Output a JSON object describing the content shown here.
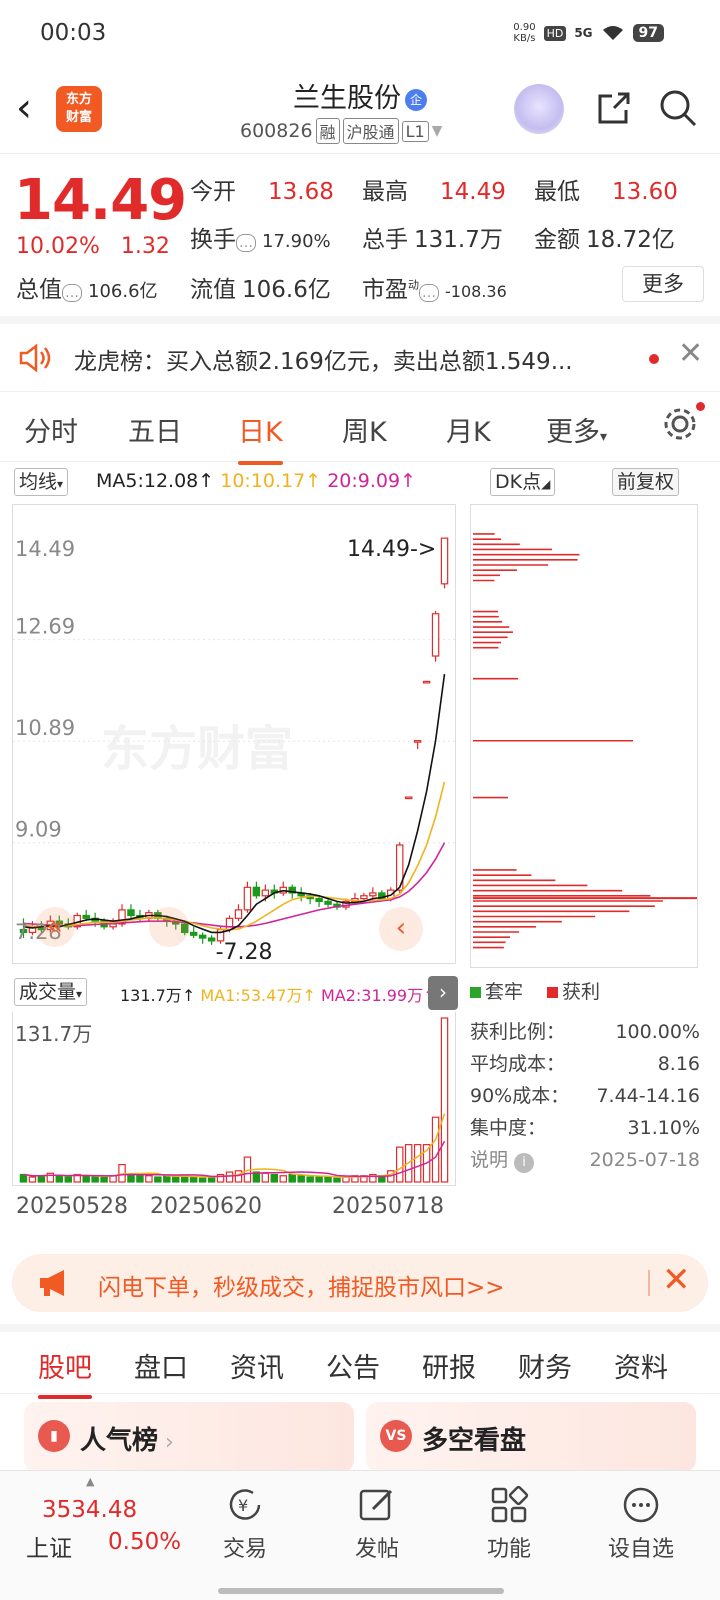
{
  "status": {
    "time": "00:03",
    "net_speed": "0.90\nKB/s",
    "hd": "HD",
    "signal": "5G",
    "battery": "97"
  },
  "header": {
    "logo_text_1": "东方",
    "logo_text_2": "财富",
    "stock_name": "兰生股份",
    "stock_badge": "企",
    "code": "600826",
    "tags": [
      "融",
      "沪股通",
      "L1"
    ]
  },
  "quote": {
    "price": "14.49",
    "change_pct": "10.02%",
    "change_amt": "1.32",
    "open_label": "今开",
    "open": "13.68",
    "high_label": "最高",
    "high": "14.49",
    "low_label": "最低",
    "low": "13.60",
    "turnover_label": "换手",
    "turnover": "17.90%",
    "volume_label": "总手",
    "volume": "131.7万",
    "amount_label": "金额",
    "amount": "18.72亿",
    "mktcap_label": "总值",
    "mktcap": "106.6亿",
    "float_label": "流值",
    "float": "106.6亿",
    "pe_label": "市盈",
    "pe_sup": "动",
    "pe": "-108.36",
    "more": "更多"
  },
  "notice": {
    "text": "龙虎榜：买入总额2.169亿元，卖出总额1.549..."
  },
  "period_tabs": [
    "分时",
    "五日",
    "日K",
    "周K",
    "月K",
    "更多"
  ],
  "active_period": "日K",
  "ma_bar": {
    "selector": "均线",
    "ma5": "MA5:12.08",
    "ma10": "10:10.17",
    "ma20": "20:9.09",
    "dk": "DK点",
    "adj": "前复权"
  },
  "chart_data": {
    "type": "candlestick",
    "y_ticks": [
      "14.49",
      "12.69",
      "10.89",
      "9.09",
      "7.28"
    ],
    "ylim": [
      7.1,
      14.9
    ],
    "last_label": "14.49->",
    "low_label": "-7.28",
    "watermark": "东方财富",
    "candles": [
      [
        7.55,
        7.5,
        7.75,
        7.4
      ],
      [
        7.5,
        7.6,
        7.7,
        7.45
      ],
      [
        7.6,
        7.55,
        7.7,
        7.5
      ],
      [
        7.55,
        7.7,
        7.8,
        7.5
      ],
      [
        7.7,
        7.65,
        7.8,
        7.6
      ],
      [
        7.65,
        7.6,
        7.75,
        7.55
      ],
      [
        7.6,
        7.8,
        7.85,
        7.55
      ],
      [
        7.8,
        7.75,
        7.9,
        7.7
      ],
      [
        7.75,
        7.7,
        7.85,
        7.6
      ],
      [
        7.7,
        7.6,
        7.75,
        7.55
      ],
      [
        7.6,
        7.65,
        7.75,
        7.55
      ],
      [
        7.65,
        7.9,
        8.0,
        7.6
      ],
      [
        7.9,
        7.8,
        8.0,
        7.75
      ],
      [
        7.8,
        7.75,
        7.9,
        7.7
      ],
      [
        7.75,
        7.85,
        7.9,
        7.7
      ],
      [
        7.85,
        7.75,
        7.9,
        7.7
      ],
      [
        7.75,
        7.7,
        7.8,
        7.6
      ],
      [
        7.7,
        7.65,
        7.75,
        7.55
      ],
      [
        7.65,
        7.5,
        7.7,
        7.45
      ],
      [
        7.5,
        7.45,
        7.6,
        7.4
      ],
      [
        7.45,
        7.4,
        7.5,
        7.3
      ],
      [
        7.4,
        7.35,
        7.45,
        7.28
      ],
      [
        7.35,
        7.55,
        7.6,
        7.3
      ],
      [
        7.55,
        7.75,
        7.8,
        7.5
      ],
      [
        7.75,
        7.9,
        8.0,
        7.7
      ],
      [
        7.9,
        8.3,
        8.4,
        7.85
      ],
      [
        8.3,
        8.15,
        8.4,
        8.1
      ],
      [
        8.15,
        8.25,
        8.35,
        8.05
      ],
      [
        8.25,
        8.2,
        8.35,
        8.1
      ],
      [
        8.2,
        8.3,
        8.4,
        8.15
      ],
      [
        8.3,
        8.2,
        8.35,
        8.1
      ],
      [
        8.2,
        8.15,
        8.3,
        8.05
      ],
      [
        8.15,
        8.1,
        8.2,
        8.0
      ],
      [
        8.1,
        8.05,
        8.15,
        7.95
      ],
      [
        8.05,
        8.0,
        8.1,
        7.95
      ],
      [
        8.0,
        7.95,
        8.05,
        7.9
      ],
      [
        7.95,
        8.05,
        8.1,
        7.9
      ],
      [
        8.05,
        8.1,
        8.2,
        8.0
      ],
      [
        8.1,
        8.15,
        8.2,
        8.05
      ],
      [
        8.15,
        8.2,
        8.3,
        8.1
      ],
      [
        8.2,
        8.1,
        8.25,
        8.05
      ],
      [
        8.1,
        8.25,
        8.3,
        8.05
      ],
      [
        8.25,
        9.05,
        9.1,
        8.2
      ],
      [
        9.9,
        9.9,
        9.9,
        9.9
      ],
      [
        10.9,
        10.9,
        10.9,
        10.75
      ],
      [
        11.95,
        11.95,
        11.95,
        11.95
      ],
      [
        12.4,
        13.15,
        13.2,
        12.3
      ],
      [
        13.68,
        14.49,
        14.49,
        13.6
      ]
    ],
    "ma5": [
      7.6,
      7.58,
      7.6,
      7.62,
      7.6,
      7.64,
      7.68,
      7.72,
      7.74,
      7.72,
      7.7,
      7.72,
      7.74,
      7.78,
      7.8,
      7.8,
      7.78,
      7.74,
      7.7,
      7.62,
      7.56,
      7.5,
      7.5,
      7.54,
      7.62,
      7.8,
      8.0,
      8.1,
      8.2,
      8.24,
      8.22,
      8.2,
      8.18,
      8.15,
      8.1,
      8.05,
      8.02,
      8.03,
      8.05,
      8.1,
      8.12,
      8.16,
      8.3,
      8.7,
      9.3,
      10.0,
      10.9,
      12.08
    ],
    "ma10": [
      7.62,
      7.61,
      7.6,
      7.6,
      7.61,
      7.62,
      7.64,
      7.66,
      7.68,
      7.68,
      7.68,
      7.7,
      7.72,
      7.74,
      7.76,
      7.76,
      7.74,
      7.72,
      7.7,
      7.66,
      7.62,
      7.58,
      7.56,
      7.55,
      7.56,
      7.62,
      7.7,
      7.8,
      7.9,
      8.0,
      8.08,
      8.12,
      8.14,
      8.14,
      8.12,
      8.1,
      8.08,
      8.06,
      8.06,
      8.07,
      8.08,
      8.1,
      8.18,
      8.38,
      8.68,
      9.05,
      9.55,
      10.17
    ],
    "ma20": [
      7.66,
      7.65,
      7.64,
      7.63,
      7.62,
      7.62,
      7.62,
      7.63,
      7.64,
      7.65,
      7.66,
      7.67,
      7.68,
      7.69,
      7.7,
      7.7,
      7.7,
      7.69,
      7.68,
      7.67,
      7.65,
      7.63,
      7.61,
      7.6,
      7.6,
      7.61,
      7.63,
      7.66,
      7.7,
      7.74,
      7.78,
      7.82,
      7.86,
      7.9,
      7.93,
      7.96,
      7.98,
      8.0,
      8.02,
      8.04,
      8.06,
      8.08,
      8.13,
      8.23,
      8.38,
      8.56,
      8.8,
      9.09
    ]
  },
  "volume_bar": {
    "selector": "成交量",
    "vol": "131.7万",
    "ma1": "MA1:53.47万",
    "ma2": "MA2:31.99万",
    "max_label": "131.7万"
  },
  "volume_data": [
    6,
    4,
    5,
    7,
    5,
    4,
    6,
    5,
    4,
    4,
    5,
    14,
    6,
    5,
    5,
    4,
    5,
    4,
    5,
    4,
    3,
    4,
    6,
    8,
    9,
    20,
    8,
    7,
    6,
    5,
    6,
    5,
    4,
    4,
    4,
    3,
    4,
    5,
    5,
    6,
    5,
    9,
    28,
    30,
    30,
    30,
    52,
    131.7
  ],
  "dates": [
    "20250528",
    "20250620",
    "20250718"
  ],
  "dk_legend": {
    "trapped": "套牢",
    "profit": "获利"
  },
  "dk_stats": [
    {
      "k": "获利比例：",
      "v": "100.00%"
    },
    {
      "k": "平均成本：",
      "v": "8.16"
    },
    {
      "k": "90%成本：",
      "v": "7.44-14.16"
    },
    {
      "k": "集中度：",
      "v": "31.10%"
    }
  ],
  "dk_note": {
    "label": "说明",
    "date": "2025-07-18"
  },
  "ad": {
    "text": "闪电下单，秒级成交，捕捉股市风口>>"
  },
  "bottom_tabs": [
    "股吧",
    "盘口",
    "资讯",
    "公告",
    "研报",
    "财务",
    "资料"
  ],
  "cards": [
    {
      "title": "人气榜",
      "icon": "chart-icon"
    },
    {
      "title": "多空看盘",
      "icon": "vs-icon"
    }
  ],
  "nav": {
    "index_value": "3534.48",
    "index_name": "上证",
    "index_pct": "0.50%",
    "items": [
      "交易",
      "发帖",
      "功能",
      "设自选"
    ]
  }
}
